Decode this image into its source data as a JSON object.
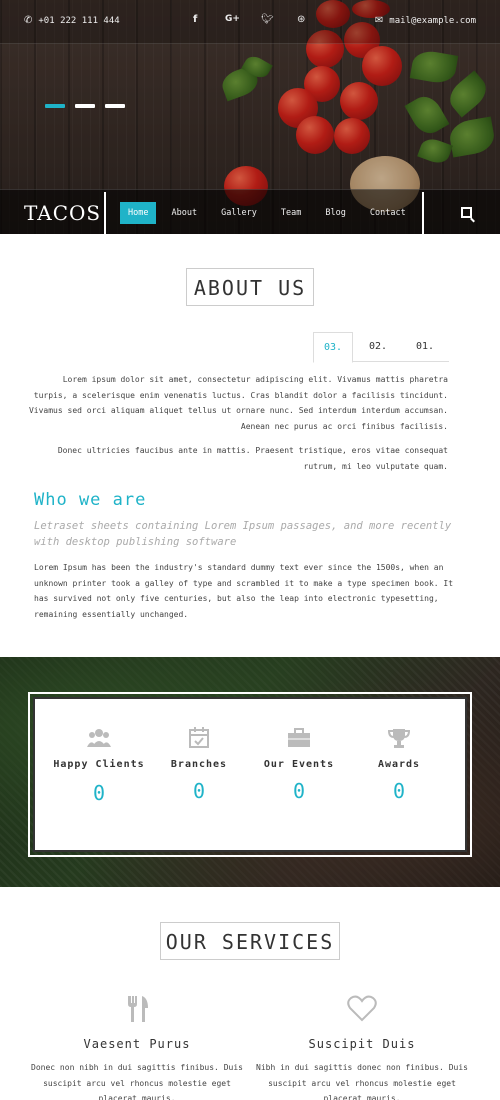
{
  "topbar": {
    "phone": "+01 222 111 444",
    "email": "mail@example.com",
    "social_icons": [
      "facebook-icon",
      "google-plus-icon",
      "twitter-icon",
      "dribbble-icon"
    ]
  },
  "hero": {
    "slides": 3,
    "active_slide": 0
  },
  "nav": {
    "logo": "TACOS",
    "items": [
      {
        "label": "Home",
        "active": true
      },
      {
        "label": "About",
        "active": false
      },
      {
        "label": "Gallery",
        "active": false
      },
      {
        "label": "Team",
        "active": false
      },
      {
        "label": "Blog",
        "active": false
      },
      {
        "label": "Contact",
        "active": false
      }
    ]
  },
  "about": {
    "title": "ABOUT US",
    "tabs": [
      {
        "label": "03.",
        "active": true
      },
      {
        "label": "02.",
        "active": false
      },
      {
        "label": "01.",
        "active": false
      }
    ],
    "paragraph1": "Lorem ipsum dolor sit amet, consectetur adipiscing elit. Vivamus mattis pharetra turpis, a scelerisque enim venenatis luctus. Cras blandit dolor a facilisis tincidunt. Vivamus sed orci aliquam aliquet tellus ut ornare nunc. Sed interdum interdum accumsan. Aenean nec purus ac orci finibus facilisis.",
    "paragraph2": "Donec ultricies faucibus ante in mattis. Praesent tristique, eros vitae consequat rutrum, mi leo vulputate quam.",
    "who_title": "Who we are",
    "who_subtitle": "Letraset sheets containing Lorem Ipsum passages, and more recently with desktop publishing software",
    "who_body": "Lorem Ipsum has been the industry's standard dummy text ever since the 1500s, when an unknown printer took a galley of type and scrambled it to make a type specimen book. It has survived not only five centuries, but also the leap into electronic typesetting, remaining essentially unchanged."
  },
  "stats": [
    {
      "label": "Happy Clients",
      "value": "0",
      "icon": "users-icon"
    },
    {
      "label": "Branches",
      "value": "0",
      "icon": "calendar-icon"
    },
    {
      "label": "Our Events",
      "value": "0",
      "icon": "briefcase-icon"
    },
    {
      "label": "Awards",
      "value": "0",
      "icon": "trophy-icon"
    }
  ],
  "services": {
    "title": "OUR SERVICES",
    "items": [
      {
        "title": "Vaesent Purus",
        "icon": "cutlery-icon",
        "text": "Donec non nibh in dui sagittis finibus. Duis suscipit arcu vel rhoncus molestie eget placerat mauris."
      },
      {
        "title": "Suscipit Duis",
        "icon": "heart-icon",
        "text": "Nibh in dui sagittis donec non finibus. Duis suscipit arcu vel rhoncus molestie eget placerat mauris."
      }
    ]
  },
  "colors": {
    "accent": "#1fb3c8",
    "text": "#444444",
    "title": "#333333"
  }
}
